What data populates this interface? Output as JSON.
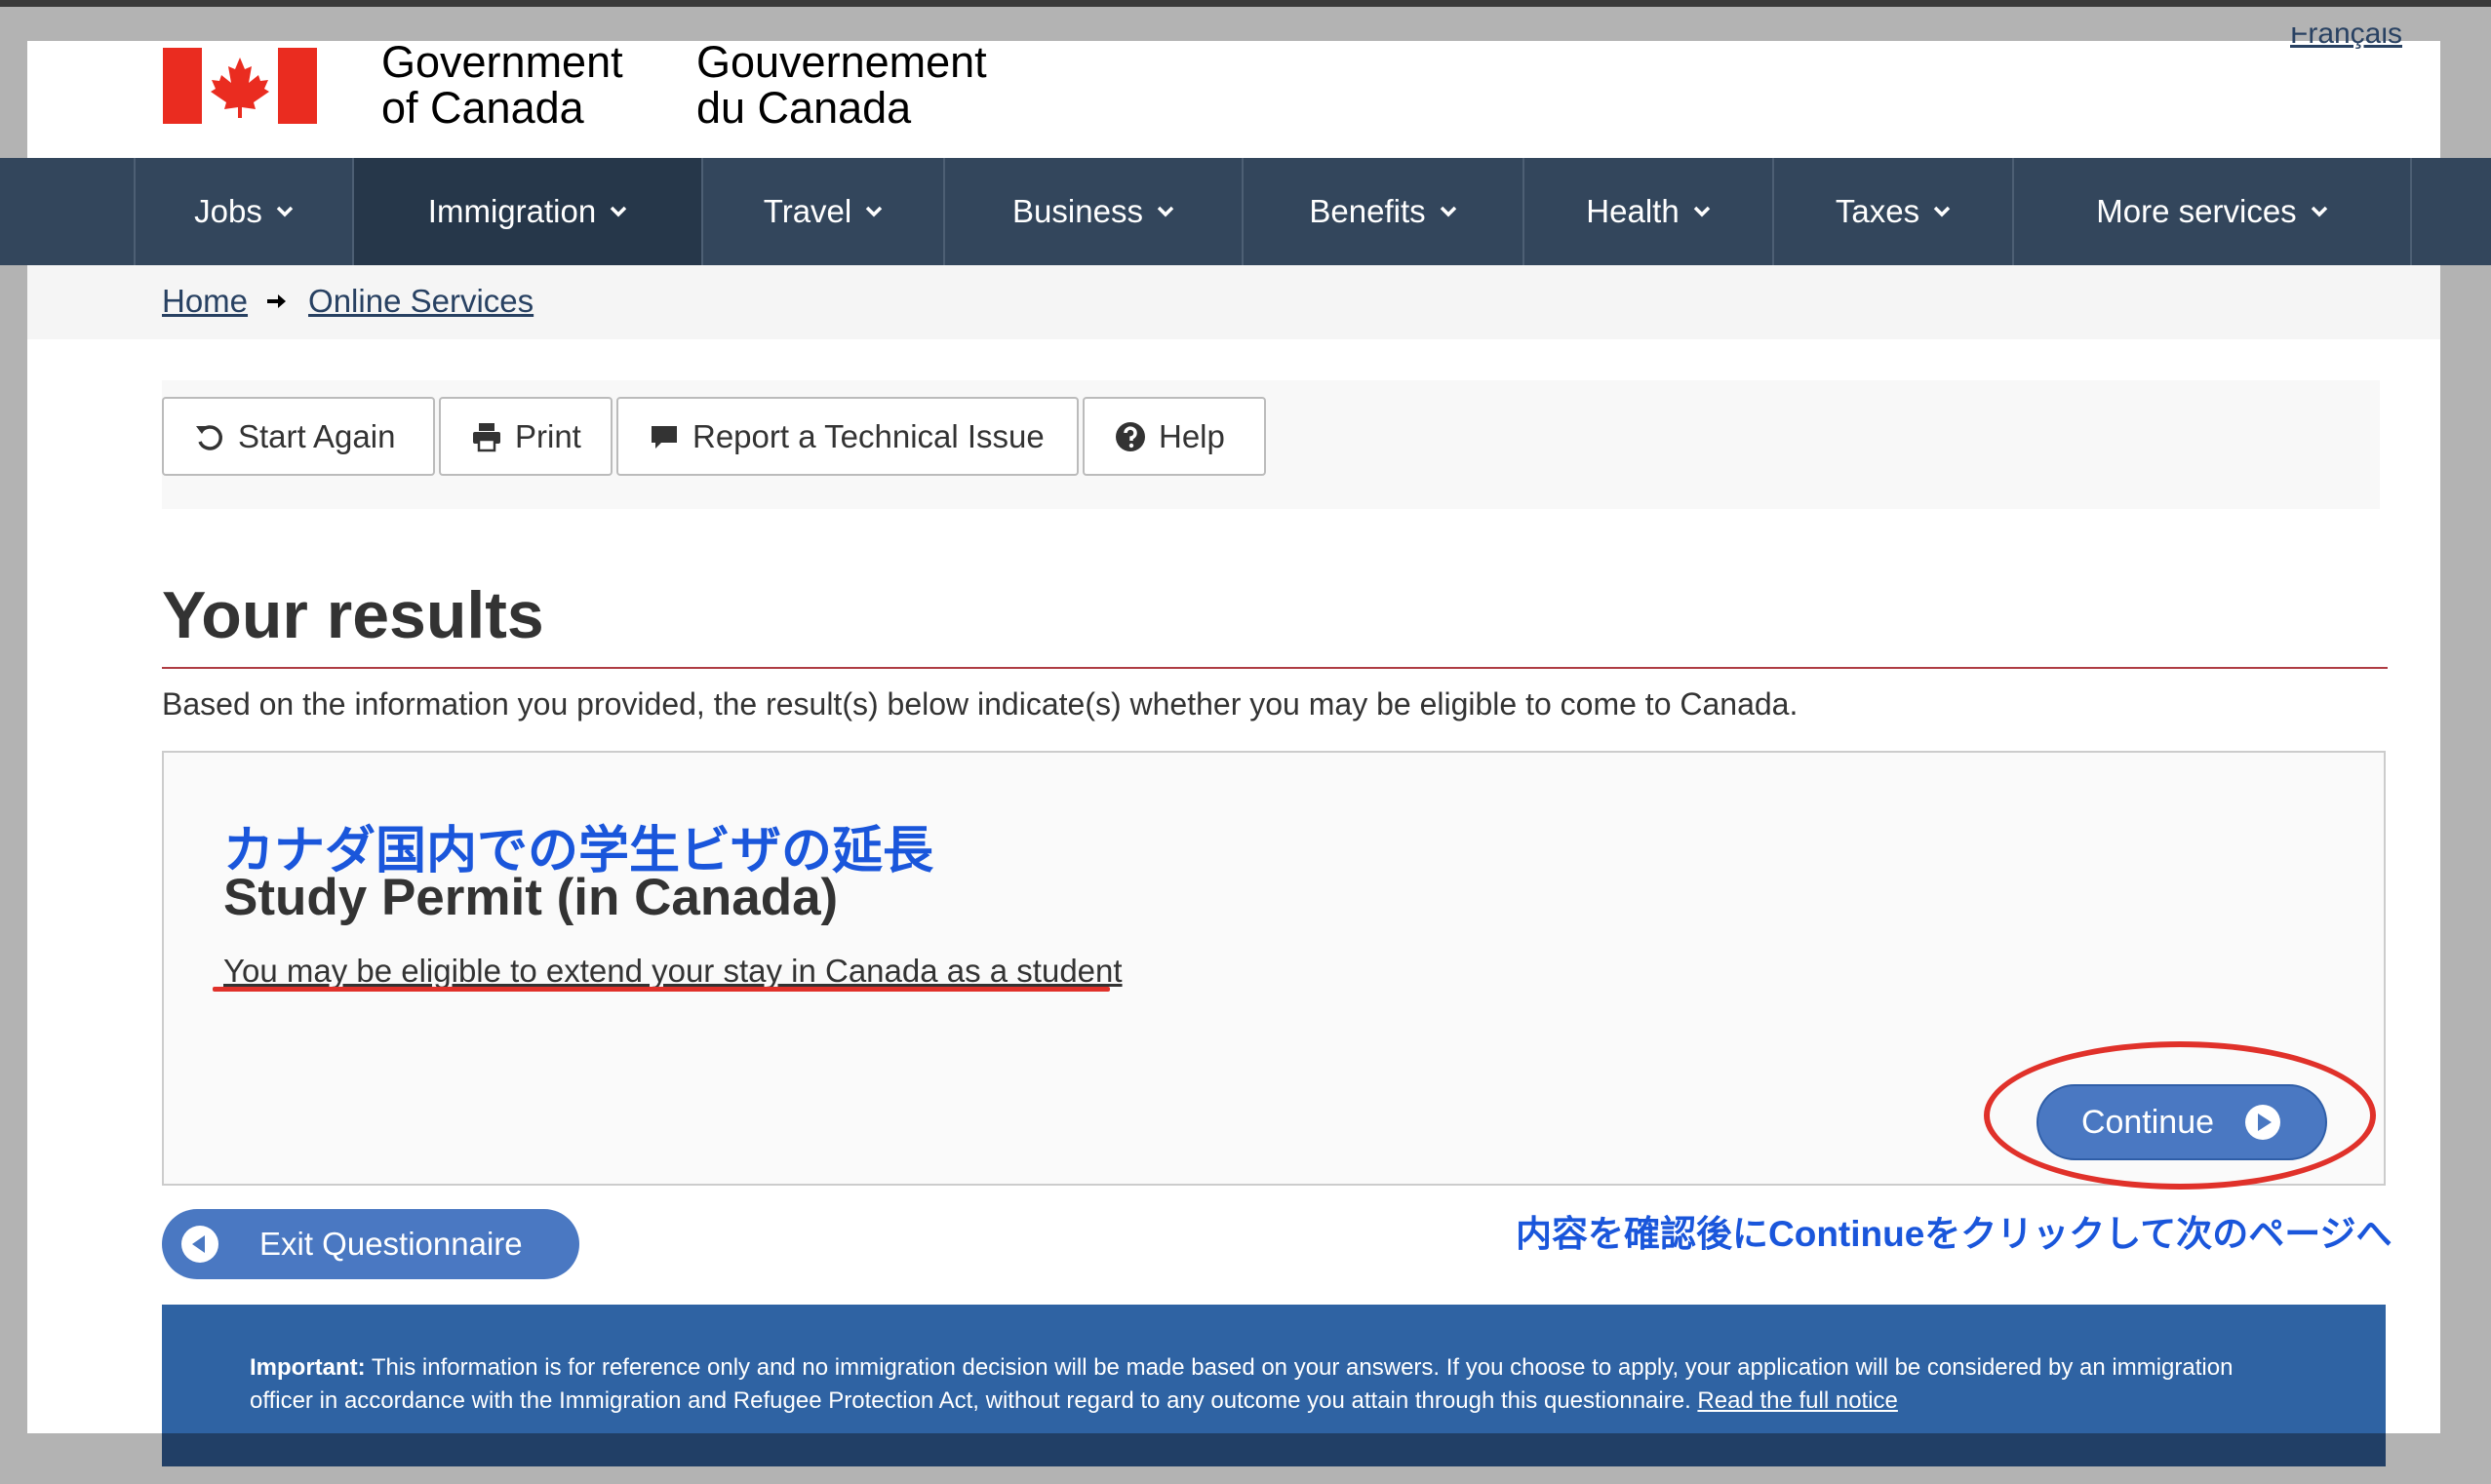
{
  "header": {
    "language_link": "Français",
    "wordmark_en_line1": "Government",
    "wordmark_en_line2": "of Canada",
    "wordmark_fr_line1": "Gouvernement",
    "wordmark_fr_line2": "du Canada"
  },
  "nav": {
    "items": [
      {
        "label": "Jobs"
      },
      {
        "label": "Immigration"
      },
      {
        "label": "Travel"
      },
      {
        "label": "Business"
      },
      {
        "label": "Benefits"
      },
      {
        "label": "Health"
      },
      {
        "label": "Taxes"
      },
      {
        "label": "More services"
      }
    ],
    "active": "Immigration"
  },
  "breadcrumb": {
    "items": [
      "Home",
      "Online Services"
    ]
  },
  "toolbar": {
    "start_again": "Start Again",
    "print": "Print",
    "report": "Report a Technical Issue",
    "help": "Help"
  },
  "main": {
    "title": "Your results",
    "intro": "Based on the information you provided, the result(s) below indicate(s) whether you may be eligible to come to Canada."
  },
  "result": {
    "annotation_title_jp": "カナダ国内での学生ビザの延長",
    "title": "Study Permit (in Canada)",
    "description": "You may be eligible to extend your stay in Canada as a student",
    "continue_label": "Continue"
  },
  "annotation_note_jp": "内容を確認後にContinueをクリックして次のページへ",
  "exit_label": "Exit Questionnaire",
  "notice": {
    "label": "Important:",
    "text": " This information is for reference only and no immigration decision will be made based on your answers. If you choose to apply, your application will be considered by an immigration officer in accordance with the Immigration and Refugee Protection Act, without regard to any outcome you attain through this questionnaire. ",
    "link": "Read the full notice"
  },
  "colors": {
    "nav_bg": "#33465c",
    "nav_active": "#26374a",
    "accent_red": "#e0312a",
    "button_blue": "#4a78c2",
    "notice_blue": "#2f63a3",
    "annotation_blue": "#1a56db"
  }
}
